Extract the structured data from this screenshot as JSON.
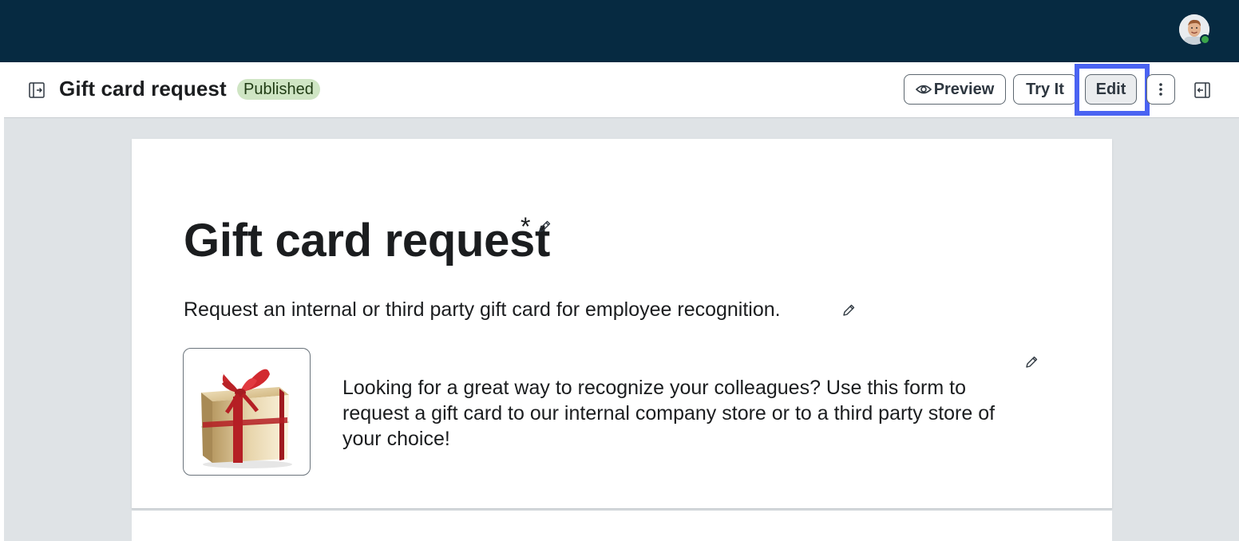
{
  "topbar": {
    "avatar_icon": "user-avatar-icon",
    "status_color": "#3aa64a"
  },
  "header": {
    "title": "Gift card request",
    "status_badge": "Published",
    "buttons": {
      "preview": "Preview",
      "try_it": "Try It",
      "edit": "Edit"
    }
  },
  "form": {
    "title": "Gift card request",
    "required_marker": "*",
    "description": "Request an internal or third party gift card for employee recognition.",
    "intro": "Looking for a great way to recognize your colleagues? Use this form to request a gift card to our internal company store or to a third party store of your choice!",
    "image_icon": "gift-box-icon"
  },
  "colors": {
    "topbar": "#062a41",
    "focus_highlight": "#4a63f2",
    "badge_bg": "#cfe5c4",
    "canvas_bg": "#dfe3e6"
  }
}
